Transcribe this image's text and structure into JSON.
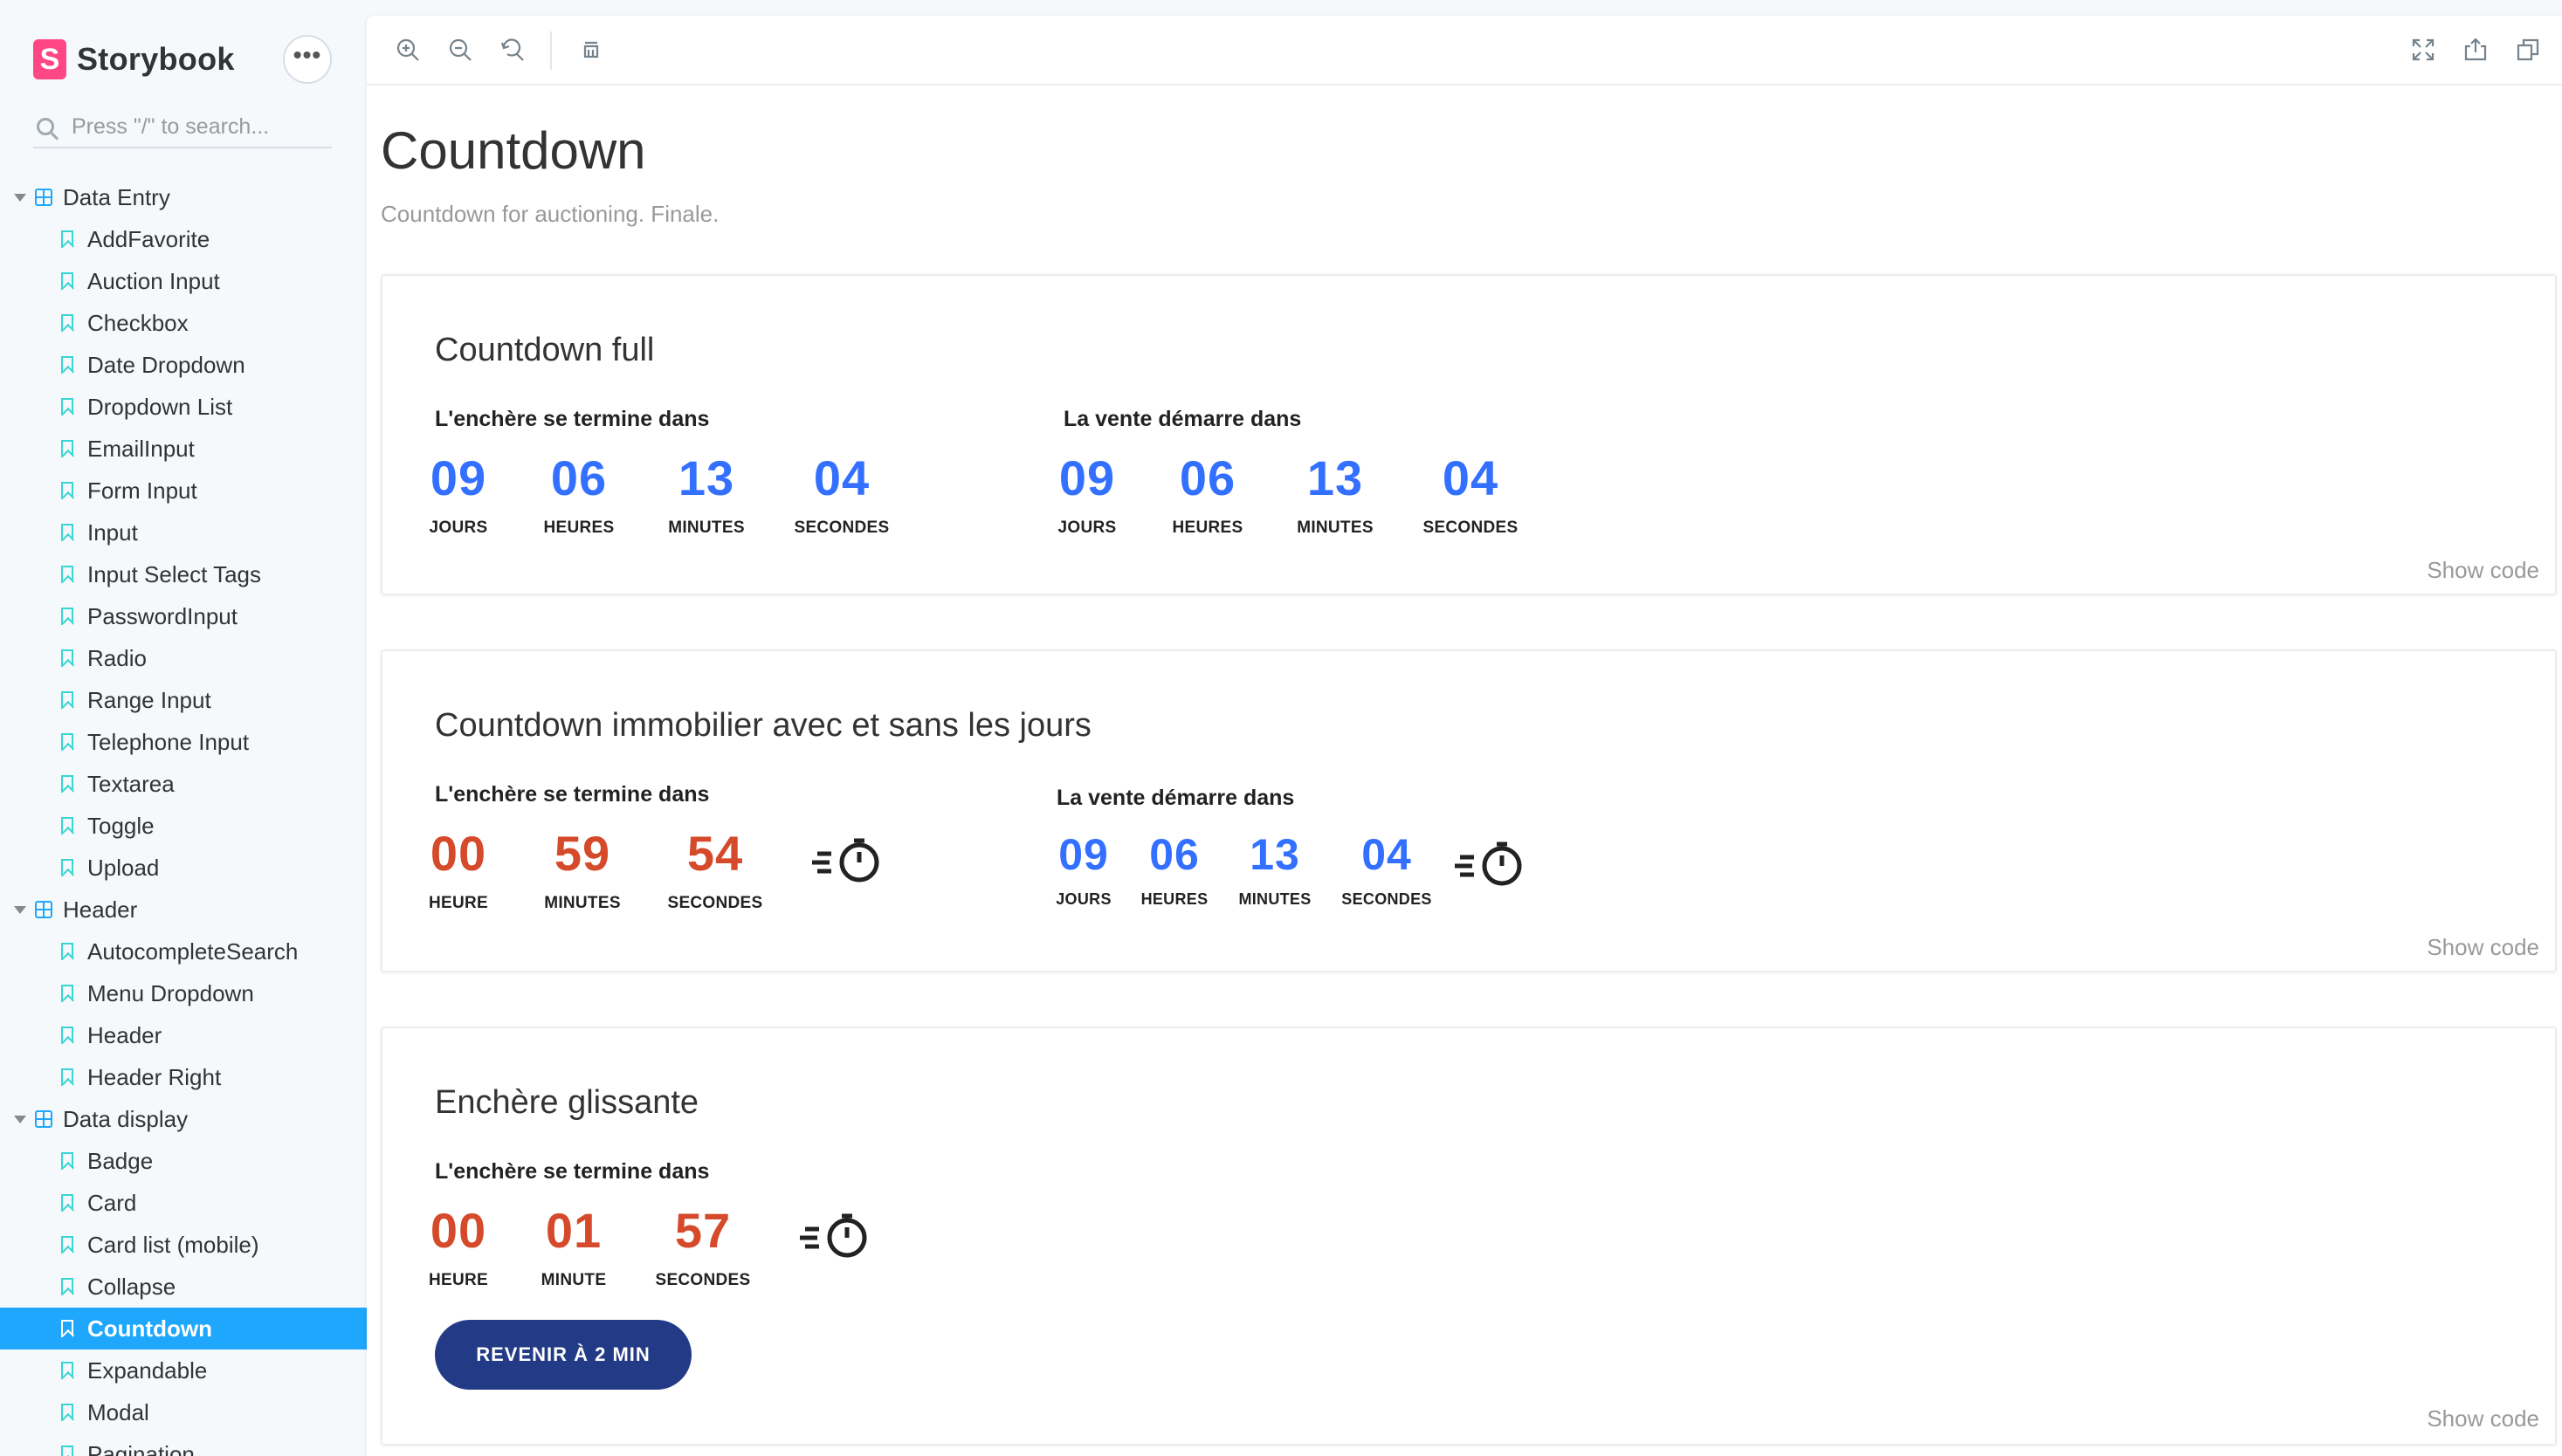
{
  "sidebar": {
    "brand": "Storybook",
    "brand_logo_letter": "S",
    "menu_glyph": "•••",
    "search_placeholder": "Press \"/\" to search...",
    "groups": [
      {
        "label": "Data Entry",
        "stories": [
          "AddFavorite",
          "Auction Input",
          "Checkbox",
          "Date Dropdown",
          "Dropdown List",
          "EmailInput",
          "Form Input",
          "Input",
          "Input Select Tags",
          "PasswordInput",
          "Radio",
          "Range Input",
          "Telephone Input",
          "Textarea",
          "Toggle",
          "Upload"
        ]
      },
      {
        "label": "Header",
        "stories": [
          "AutocompleteSearch",
          "Menu Dropdown",
          "Header",
          "Header Right"
        ]
      },
      {
        "label": "Data display",
        "stories": [
          "Badge",
          "Card",
          "Card list (mobile)",
          "Collapse",
          "Countdown",
          "Expandable",
          "Modal",
          "Pagination"
        ]
      }
    ],
    "active_story": "Countdown"
  },
  "toolbar": {
    "left_icons": [
      "zoom-in-icon",
      "zoom-out-icon",
      "zoom-reset-icon",
      "background-icon"
    ],
    "right_icons": [
      "fullscreen-icon",
      "share-icon",
      "copy-icon"
    ]
  },
  "page": {
    "title": "Countdown",
    "subtitle": "Countdown for auctioning. Finale."
  },
  "cards": {
    "full": {
      "title": "Countdown full",
      "left_label": "L'enchère se termine dans",
      "left_blocks": [
        {
          "value": "09",
          "unit": "JOURS"
        },
        {
          "value": "06",
          "unit": "HEURES"
        },
        {
          "value": "13",
          "unit": "MINUTES"
        },
        {
          "value": "04",
          "unit": "SECONDES"
        }
      ],
      "right_label": "La vente démarre dans",
      "right_blocks": [
        {
          "value": "09",
          "unit": "JOURS"
        },
        {
          "value": "06",
          "unit": "HEURES"
        },
        {
          "value": "13",
          "unit": "MINUTES"
        },
        {
          "value": "04",
          "unit": "SECONDES"
        }
      ],
      "show_code": "Show code"
    },
    "immo": {
      "title": "Countdown immobilier avec et sans les jours",
      "left_label": "L'enchère se termine dans",
      "left_blocks": [
        {
          "value": "00",
          "unit": "HEURE"
        },
        {
          "value": "59",
          "unit": "MINUTES"
        },
        {
          "value": "54",
          "unit": "SECONDES"
        }
      ],
      "right_label": "La vente démarre dans",
      "right_blocks": [
        {
          "value": "09",
          "unit": "JOURS"
        },
        {
          "value": "06",
          "unit": "HEURES"
        },
        {
          "value": "13",
          "unit": "MINUTES"
        },
        {
          "value": "04",
          "unit": "SECONDES"
        }
      ],
      "show_code": "Show code"
    },
    "glissante": {
      "title": "Enchère glissante",
      "label": "L'enchère se termine dans",
      "blocks": [
        {
          "value": "00",
          "unit": "HEURE"
        },
        {
          "value": "01",
          "unit": "MINUTE"
        },
        {
          "value": "57",
          "unit": "SECONDES"
        }
      ],
      "button": "REVENIR À 2 MIN",
      "show_code": "Show code"
    }
  },
  "colors": {
    "blue_digits": "#3370ff",
    "red_digits": "#d54a2a",
    "active_item": "#1ea7fd",
    "button": "#233a86",
    "brand": "#ff4785"
  }
}
